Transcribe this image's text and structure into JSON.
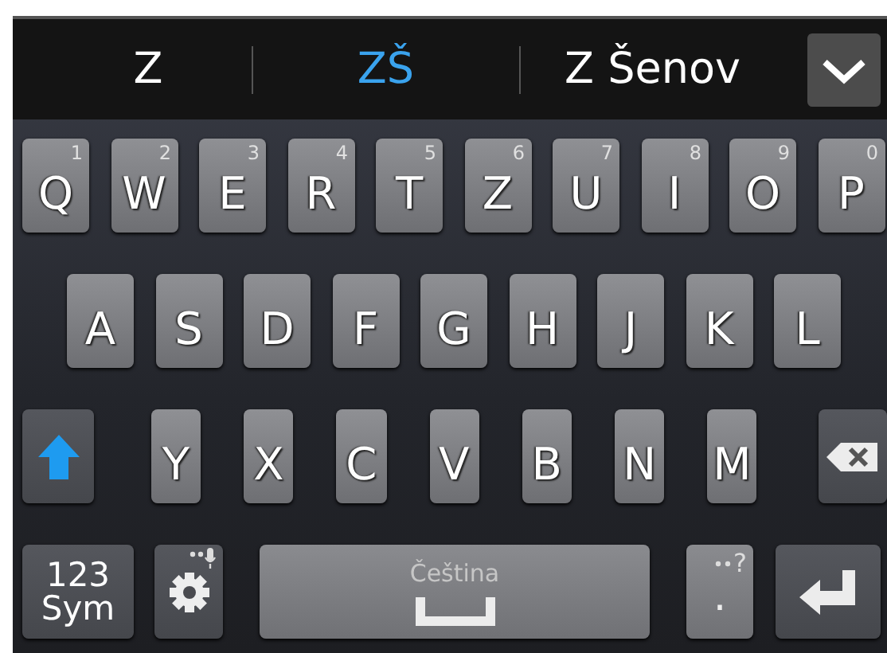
{
  "suggestions": [
    {
      "text": "Z",
      "selected": false
    },
    {
      "text": "ZŠ",
      "selected": true
    },
    {
      "text": "Z Šenov",
      "selected": false
    }
  ],
  "rows": [
    [
      {
        "kind": "letter",
        "label": "Q",
        "hint": "1"
      },
      {
        "kind": "letter",
        "label": "W",
        "hint": "2"
      },
      {
        "kind": "letter",
        "label": "E",
        "hint": "3"
      },
      {
        "kind": "letter",
        "label": "R",
        "hint": "4"
      },
      {
        "kind": "letter",
        "label": "T",
        "hint": "5"
      },
      {
        "kind": "letter",
        "label": "Z",
        "hint": "6"
      },
      {
        "kind": "letter",
        "label": "U",
        "hint": "7"
      },
      {
        "kind": "letter",
        "label": "I",
        "hint": "8"
      },
      {
        "kind": "letter",
        "label": "O",
        "hint": "9"
      },
      {
        "kind": "letter",
        "label": "P",
        "hint": "0"
      }
    ],
    [
      {
        "kind": "letter",
        "label": "A"
      },
      {
        "kind": "letter",
        "label": "S"
      },
      {
        "kind": "letter",
        "label": "D"
      },
      {
        "kind": "letter",
        "label": "F"
      },
      {
        "kind": "letter",
        "label": "G"
      },
      {
        "kind": "letter",
        "label": "H"
      },
      {
        "kind": "letter",
        "label": "J"
      },
      {
        "kind": "letter",
        "label": "K"
      },
      {
        "kind": "letter",
        "label": "L"
      }
    ],
    [
      {
        "kind": "shift",
        "active": true
      },
      {
        "kind": "letter",
        "label": "Y"
      },
      {
        "kind": "letter",
        "label": "X"
      },
      {
        "kind": "letter",
        "label": "C"
      },
      {
        "kind": "letter",
        "label": "V"
      },
      {
        "kind": "letter",
        "label": "B"
      },
      {
        "kind": "letter",
        "label": "N"
      },
      {
        "kind": "letter",
        "label": "M"
      },
      {
        "kind": "backspace"
      }
    ],
    [
      {
        "kind": "symbols",
        "label": "123\nSym"
      },
      {
        "kind": "settings"
      },
      {
        "kind": "space",
        "label": "Čeština"
      },
      {
        "kind": "period",
        "label": ".",
        "hint": "?"
      },
      {
        "kind": "enter"
      }
    ]
  ]
}
